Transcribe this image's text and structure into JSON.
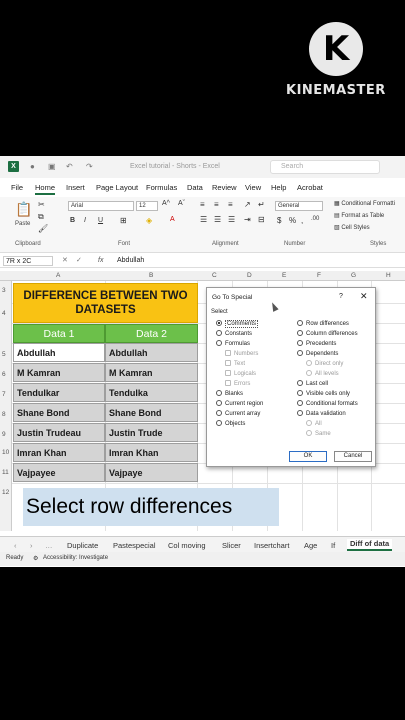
{
  "watermark": {
    "logo_letter": "K",
    "brand": "KINEMASTER"
  },
  "titlebar": {
    "title": "Excel tutorial - Shorts - Excel",
    "search_placeholder": "Search"
  },
  "ribbon_tabs": [
    "File",
    "Home",
    "Insert",
    "Page Layout",
    "Formulas",
    "Data",
    "Review",
    "View",
    "Help",
    "Acrobat"
  ],
  "ribbon": {
    "paste": "Paste",
    "clipboard": "Clipboard",
    "font_name": "Arial",
    "font_size": "12",
    "font": "Font",
    "alignment": "Alignment",
    "number_format": "General",
    "number": "Number",
    "conditional_formatting": "Conditional Formatti",
    "format_as_table": "Format as Table",
    "cell_styles": "Cell Styles",
    "styles": "Styles"
  },
  "formula_bar": {
    "name_box": "7R x 2C",
    "fx": "fx",
    "value": "Abdullah"
  },
  "columns": [
    "A",
    "B",
    "C",
    "D",
    "E",
    "F",
    "G",
    "H"
  ],
  "rows": [
    "3",
    "4",
    "5",
    "6",
    "7",
    "8",
    "9",
    "10",
    "11",
    "12"
  ],
  "sheet": {
    "title": "DIFFERENCE BETWEEN TWO DATASETS",
    "headers": [
      "Data 1",
      "Data 2"
    ],
    "data": [
      [
        "Abdullah",
        "Abdullah"
      ],
      [
        "M Kamran",
        "M Kamran"
      ],
      [
        "Tendulkar",
        "Tendulka"
      ],
      [
        "Shane Bond",
        "Shane Bond"
      ],
      [
        "Justin Trudeau",
        "Justin Trude"
      ],
      [
        "Imran Khan",
        "Imran Khan"
      ],
      [
        "Vajpayee",
        "Vajpaye"
      ]
    ]
  },
  "dialog": {
    "title": "Go To Special",
    "help": "?",
    "close": "✕",
    "select_label": "Select",
    "left_options": [
      "Comments",
      "Constants",
      "Formulas",
      "Numbers",
      "Text",
      "Logicals",
      "Errors",
      "Blanks",
      "Current region",
      "Current array",
      "Objects"
    ],
    "right_options": [
      "Row differences",
      "Column differences",
      "Precedents",
      "Dependents",
      "Direct only",
      "All levels",
      "Last cell",
      "Visible cells only",
      "Conditional formats",
      "Data validation",
      "All",
      "Same"
    ],
    "ok": "OK",
    "cancel": "Cancel"
  },
  "caption": "Select row differences",
  "sheet_tabs": [
    "Duplicate",
    "Pastespecial",
    "Col moving",
    "Slicer",
    "Insertchart",
    "Age",
    "If",
    "Diff of data"
  ],
  "status": {
    "ready": "Ready",
    "accessibility": "Accessibility: Investigate"
  },
  "colors": {
    "title_fill": "#f9c213",
    "header_fill": "#6cc04a",
    "data_fill": "#d4d4d4",
    "caption_bg": "#cfe0ef",
    "excel_green": "#1d6f42"
  }
}
